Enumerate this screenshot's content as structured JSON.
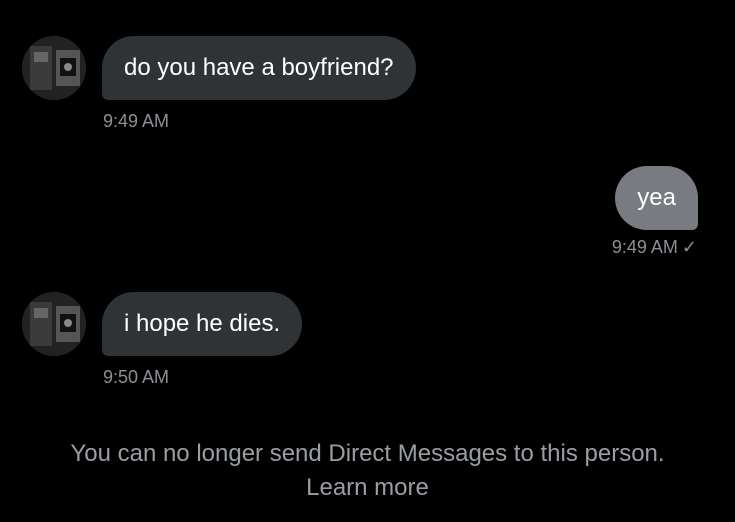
{
  "messages": [
    {
      "direction": "incoming",
      "text": "do you have a boyfriend?",
      "time": "9:49 AM"
    },
    {
      "direction": "outgoing",
      "text": "yea",
      "time": "9:49 AM",
      "status_icon": "check-icon",
      "status_glyph": "✓"
    },
    {
      "direction": "incoming",
      "text": "i hope he dies.",
      "time": "9:50 AM"
    }
  ],
  "notice": {
    "text": "You can no longer send Direct Messages to this person.",
    "link": "Learn more"
  },
  "avatar_icon": "profile-photo-avatar",
  "colors": {
    "background": "#000000",
    "incoming_bubble": "#2f3336",
    "outgoing_bubble": "#787b80",
    "timestamp": "#8b8f94"
  }
}
